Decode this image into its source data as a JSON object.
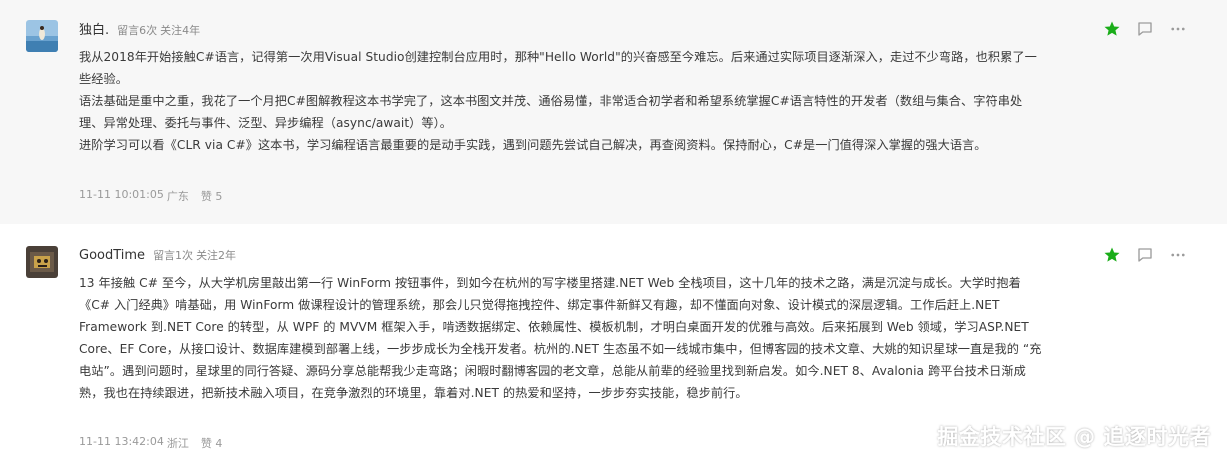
{
  "comments": [
    {
      "username": "独白.",
      "stats": [
        "留言6次",
        "关注4年"
      ],
      "paragraphs": [
        "我从2018年开始接触C#语言，记得第一次用Visual Studio创建控制台应用时，那种\"Hello World\"的兴奋感至今难忘。后来通过实际项目逐渐深入，走过不少弯路，也积累了一些经验。",
        "语法基础是重中之重，我花了一个月把C#图解教程这本书学完了，这本书图文并茂、通俗易懂，非常适合初学者和希望系统掌握C#语言特性的开发者（数组与集合、字符串处理、异常处理、委托与事件、泛型、异步编程（async/await）等）。",
        "进阶学习可以看《CLR via C#》这本书，学习编程语言最重要的是动手实践，遇到问题先尝试自己解决，再查阅资料。保持耐心，C#是一门值得深入掌握的强大语言。"
      ],
      "time": "11-11 10:01:05",
      "location": "广东",
      "likes": "赞 5"
    },
    {
      "username": "GoodTime",
      "stats": [
        "留言1次",
        "关注2年"
      ],
      "paragraphs": [
        "13 年接触 C# 至今，从大学机房里敲出第一行 WinForm 按钮事件，到如今在杭州的写字楼里搭建.NET Web 全栈项目，这十几年的技术之路，满是沉淀与成长。大学时抱着《C# 入门经典》啃基础，用 WinForm 做课程设计的管理系统，那会儿只觉得拖拽控件、绑定事件新鲜又有趣，却不懂面向对象、设计模式的深层逻辑。工作后赶上.NET Framework 到.NET Core 的转型，从 WPF 的 MVVM 框架入手，啃透数据绑定、依赖属性、模板机制，才明白桌面开发的优雅与高效。后来拓展到 Web 领域，学习ASP.NET Core、EF Core，从接口设计、数据库建模到部署上线，一步步成长为全栈开发者。杭州的.NET 生态虽不如一线城市集中，但博客园的技术文章、大姚的知识星球一直是我的 “充电站”。遇到问题时，星球里的同行答疑、源码分享总能帮我少走弯路；闲暇时翻博客园的老文章，总能从前辈的经验里找到新启发。如今.NET 8、Avalonia 跨平台技术日渐成熟，我也在持续跟进，把新技术融入项目，在竞争激烈的环境里，靠着对.NET 的热爱和坚持，一步步夯实技能，稳步前行。"
      ],
      "time": "11-11 13:42:04",
      "location": "浙江",
      "likes": "赞 4"
    }
  ],
  "watermark": "掘金技术社区 @ 追逐时光者",
  "icons": {
    "favorite": "star-icon",
    "reply": "comment-icon",
    "more": "more-dots-icon"
  },
  "colors": {
    "star": "#1aad19",
    "icon_gray": "#9b9b9b",
    "meta_gray": "#9a9a9a",
    "card_bg": "#f7f7f7"
  }
}
